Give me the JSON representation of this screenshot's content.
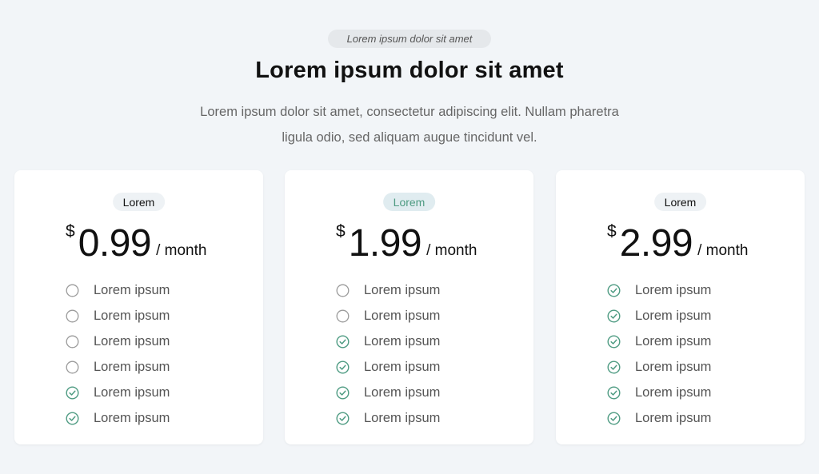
{
  "eyebrow": "Lorem ipsum dolor sit amet",
  "headline": "Lorem ipsum dolor sit amet",
  "subtext": "Lorem ipsum dolor sit amet, consectetur adipiscing elit. Nullam pharetra ligula odio, sed aliquam augue tincidunt vel.",
  "colors": {
    "background": "#f2f5f8",
    "accent": "#4e9b82",
    "muted_icon": "#9a9a9a",
    "card": "#ffffff"
  },
  "plans": [
    {
      "tier": "Lorem",
      "featured": false,
      "currency": "$",
      "amount": "0.99",
      "period": "/ month",
      "features": [
        {
          "label": "Lorem ipsum",
          "included": false,
          "icon": "empty-circle-icon"
        },
        {
          "label": "Lorem ipsum",
          "included": false,
          "icon": "empty-circle-icon"
        },
        {
          "label": "Lorem ipsum",
          "included": false,
          "icon": "empty-circle-icon"
        },
        {
          "label": "Lorem ipsum",
          "included": false,
          "icon": "empty-circle-icon"
        },
        {
          "label": "Lorem ipsum",
          "included": true,
          "icon": "check-circle-icon"
        },
        {
          "label": "Lorem ipsum",
          "included": true,
          "icon": "check-circle-icon"
        }
      ]
    },
    {
      "tier": "Lorem",
      "featured": true,
      "currency": "$",
      "amount": "1.99",
      "period": "/ month",
      "features": [
        {
          "label": "Lorem ipsum",
          "included": false,
          "icon": "empty-circle-icon"
        },
        {
          "label": "Lorem ipsum",
          "included": false,
          "icon": "empty-circle-icon"
        },
        {
          "label": "Lorem ipsum",
          "included": true,
          "icon": "check-circle-icon"
        },
        {
          "label": "Lorem ipsum",
          "included": true,
          "icon": "check-circle-icon"
        },
        {
          "label": "Lorem ipsum",
          "included": true,
          "icon": "check-circle-icon"
        },
        {
          "label": "Lorem ipsum",
          "included": true,
          "icon": "check-circle-icon"
        }
      ]
    },
    {
      "tier": "Lorem",
      "featured": false,
      "currency": "$",
      "amount": "2.99",
      "period": "/ month",
      "features": [
        {
          "label": "Lorem ipsum",
          "included": true,
          "icon": "check-circle-icon"
        },
        {
          "label": "Lorem ipsum",
          "included": true,
          "icon": "check-circle-icon"
        },
        {
          "label": "Lorem ipsum",
          "included": true,
          "icon": "check-circle-icon"
        },
        {
          "label": "Lorem ipsum",
          "included": true,
          "icon": "check-circle-icon"
        },
        {
          "label": "Lorem ipsum",
          "included": true,
          "icon": "check-circle-icon"
        },
        {
          "label": "Lorem ipsum",
          "included": true,
          "icon": "check-circle-icon"
        }
      ]
    }
  ]
}
